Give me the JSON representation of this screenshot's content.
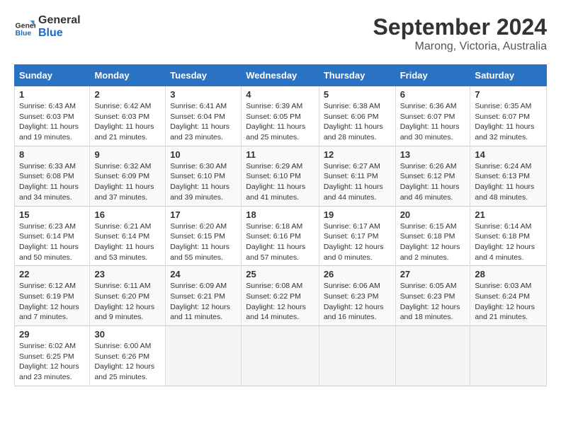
{
  "logo": {
    "line1": "General",
    "line2": "Blue"
  },
  "title": "September 2024",
  "subtitle": "Marong, Victoria, Australia",
  "days_header": [
    "Sunday",
    "Monday",
    "Tuesday",
    "Wednesday",
    "Thursday",
    "Friday",
    "Saturday"
  ],
  "weeks": [
    [
      {
        "num": "1",
        "sunrise": "6:43 AM",
        "sunset": "6:03 PM",
        "daylight": "11 hours and 19 minutes."
      },
      {
        "num": "2",
        "sunrise": "6:42 AM",
        "sunset": "6:03 PM",
        "daylight": "11 hours and 21 minutes."
      },
      {
        "num": "3",
        "sunrise": "6:41 AM",
        "sunset": "6:04 PM",
        "daylight": "11 hours and 23 minutes."
      },
      {
        "num": "4",
        "sunrise": "6:39 AM",
        "sunset": "6:05 PM",
        "daylight": "11 hours and 25 minutes."
      },
      {
        "num": "5",
        "sunrise": "6:38 AM",
        "sunset": "6:06 PM",
        "daylight": "11 hours and 28 minutes."
      },
      {
        "num": "6",
        "sunrise": "6:36 AM",
        "sunset": "6:07 PM",
        "daylight": "11 hours and 30 minutes."
      },
      {
        "num": "7",
        "sunrise": "6:35 AM",
        "sunset": "6:07 PM",
        "daylight": "11 hours and 32 minutes."
      }
    ],
    [
      {
        "num": "8",
        "sunrise": "6:33 AM",
        "sunset": "6:08 PM",
        "daylight": "11 hours and 34 minutes."
      },
      {
        "num": "9",
        "sunrise": "6:32 AM",
        "sunset": "6:09 PM",
        "daylight": "11 hours and 37 minutes."
      },
      {
        "num": "10",
        "sunrise": "6:30 AM",
        "sunset": "6:10 PM",
        "daylight": "11 hours and 39 minutes."
      },
      {
        "num": "11",
        "sunrise": "6:29 AM",
        "sunset": "6:10 PM",
        "daylight": "11 hours and 41 minutes."
      },
      {
        "num": "12",
        "sunrise": "6:27 AM",
        "sunset": "6:11 PM",
        "daylight": "11 hours and 44 minutes."
      },
      {
        "num": "13",
        "sunrise": "6:26 AM",
        "sunset": "6:12 PM",
        "daylight": "11 hours and 46 minutes."
      },
      {
        "num": "14",
        "sunrise": "6:24 AM",
        "sunset": "6:13 PM",
        "daylight": "11 hours and 48 minutes."
      }
    ],
    [
      {
        "num": "15",
        "sunrise": "6:23 AM",
        "sunset": "6:14 PM",
        "daylight": "11 hours and 50 minutes."
      },
      {
        "num": "16",
        "sunrise": "6:21 AM",
        "sunset": "6:14 PM",
        "daylight": "11 hours and 53 minutes."
      },
      {
        "num": "17",
        "sunrise": "6:20 AM",
        "sunset": "6:15 PM",
        "daylight": "11 hours and 55 minutes."
      },
      {
        "num": "18",
        "sunrise": "6:18 AM",
        "sunset": "6:16 PM",
        "daylight": "11 hours and 57 minutes."
      },
      {
        "num": "19",
        "sunrise": "6:17 AM",
        "sunset": "6:17 PM",
        "daylight": "12 hours and 0 minutes."
      },
      {
        "num": "20",
        "sunrise": "6:15 AM",
        "sunset": "6:18 PM",
        "daylight": "12 hours and 2 minutes."
      },
      {
        "num": "21",
        "sunrise": "6:14 AM",
        "sunset": "6:18 PM",
        "daylight": "12 hours and 4 minutes."
      }
    ],
    [
      {
        "num": "22",
        "sunrise": "6:12 AM",
        "sunset": "6:19 PM",
        "daylight": "12 hours and 7 minutes."
      },
      {
        "num": "23",
        "sunrise": "6:11 AM",
        "sunset": "6:20 PM",
        "daylight": "12 hours and 9 minutes."
      },
      {
        "num": "24",
        "sunrise": "6:09 AM",
        "sunset": "6:21 PM",
        "daylight": "12 hours and 11 minutes."
      },
      {
        "num": "25",
        "sunrise": "6:08 AM",
        "sunset": "6:22 PM",
        "daylight": "12 hours and 14 minutes."
      },
      {
        "num": "26",
        "sunrise": "6:06 AM",
        "sunset": "6:23 PM",
        "daylight": "12 hours and 16 minutes."
      },
      {
        "num": "27",
        "sunrise": "6:05 AM",
        "sunset": "6:23 PM",
        "daylight": "12 hours and 18 minutes."
      },
      {
        "num": "28",
        "sunrise": "6:03 AM",
        "sunset": "6:24 PM",
        "daylight": "12 hours and 21 minutes."
      }
    ],
    [
      {
        "num": "29",
        "sunrise": "6:02 AM",
        "sunset": "6:25 PM",
        "daylight": "12 hours and 23 minutes."
      },
      {
        "num": "30",
        "sunrise": "6:00 AM",
        "sunset": "6:26 PM",
        "daylight": "12 hours and 25 minutes."
      },
      null,
      null,
      null,
      null,
      null
    ]
  ],
  "labels": {
    "sunrise": "Sunrise:",
    "sunset": "Sunset:",
    "daylight": "Daylight:"
  }
}
